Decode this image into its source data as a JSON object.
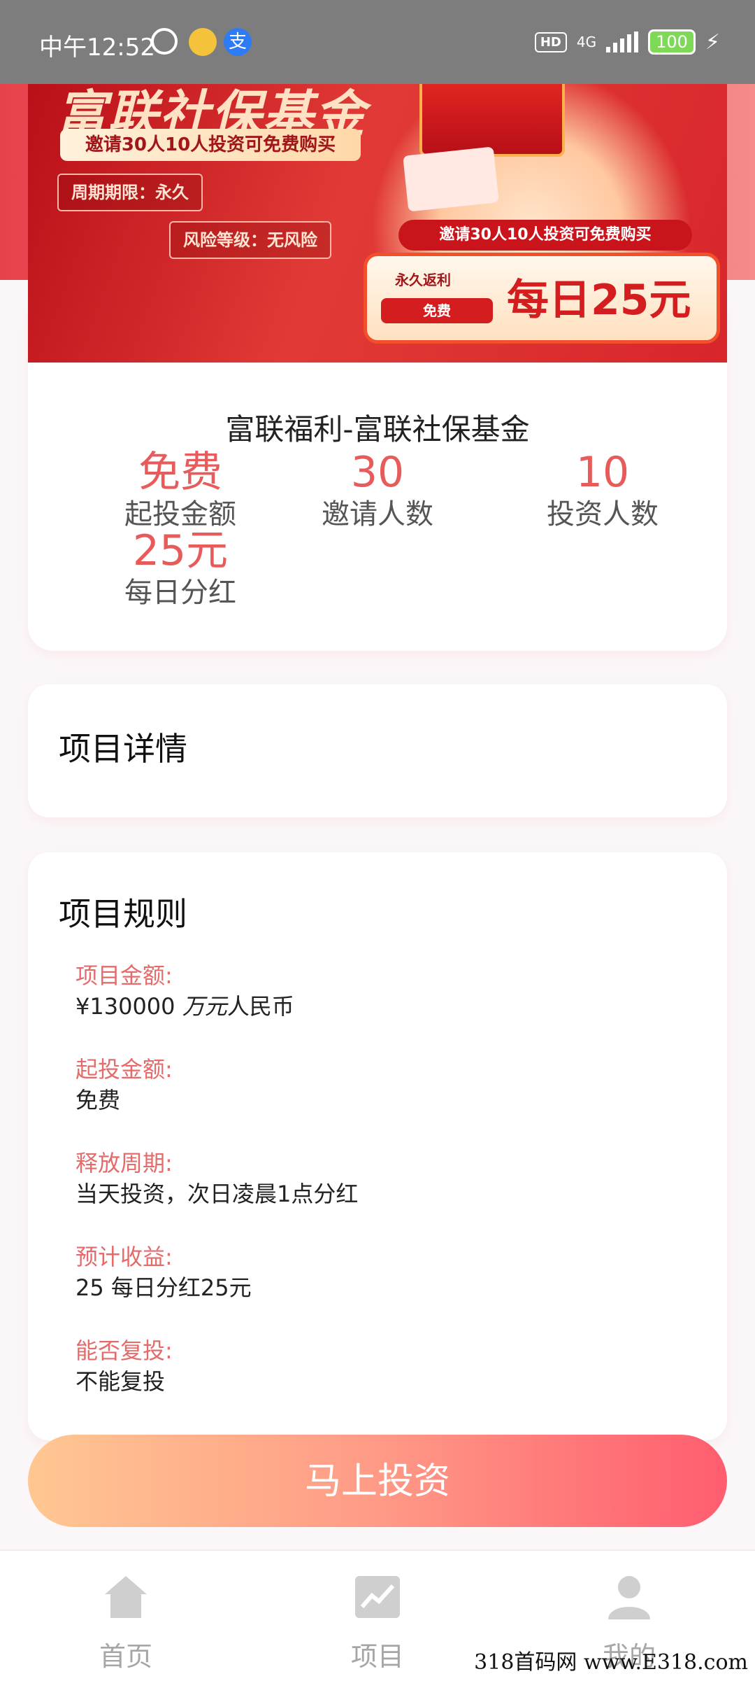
{
  "status_bar": {
    "time": "中午12:52",
    "hd": "HD",
    "network": "4G",
    "battery": "100"
  },
  "banner": {
    "title": "富联社保基金",
    "strip": "邀请30人10人投资可免费购买",
    "tag_period": "周期期限：永久",
    "tag_risk": "风险等级：无风险",
    "pill": "邀请30人10人投资可免费购买",
    "sub1": "永久返利",
    "sub2": "免费",
    "big": "每日25元"
  },
  "product": {
    "title": "富联福利-富联社保基金",
    "stats": [
      {
        "value": "免费",
        "label": "起投金额"
      },
      {
        "value": "30",
        "label": "邀请人数"
      },
      {
        "value": "10",
        "label": "投资人数"
      },
      {
        "value": "25元",
        "label": "每日分红"
      }
    ]
  },
  "details": {
    "heading": "项目详情"
  },
  "rules": {
    "heading": "项目规则",
    "items": [
      {
        "key": "项目金额:",
        "value_prefix": "¥130000 ",
        "value_italic": "万元",
        "value_suffix": "人民币"
      },
      {
        "key": "起投金额:",
        "value": "免费"
      },
      {
        "key": "释放周期:",
        "value": "当天投资，次日凌晨1点分红"
      },
      {
        "key": "预计收益:",
        "value": "25 每日分红25元"
      },
      {
        "key": "能否复投:",
        "value": "不能复投"
      }
    ]
  },
  "invest_button": "马上投资",
  "nav": [
    {
      "label": "首页",
      "icon": "home-icon"
    },
    {
      "label": "项目",
      "icon": "chart-icon"
    },
    {
      "label": "我的",
      "icon": "user-icon"
    }
  ],
  "watermark": "318首码网 www.E318.com",
  "colors": {
    "accent": "#e85b5b",
    "button_start": "#ffc792",
    "button_end": "#ff5d6f",
    "banner_red": "#d31d1f"
  }
}
